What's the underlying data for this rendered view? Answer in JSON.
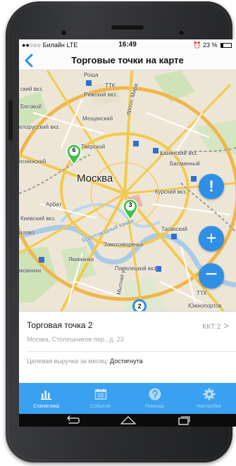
{
  "status": {
    "carrier": "●●○○○ Билайн  LTE",
    "time": "16:49",
    "battery": "23 %"
  },
  "nav": {
    "title": "Торговые точки на карте"
  },
  "map": {
    "city": "Москва",
    "labels": {
      "rogozh": "Рощa",
      "ttk_top": "ТТК",
      "rizhsky": "Рижский вкз.",
      "rizhsky_left": "ский вкз.",
      "begovoy": "Беговой",
      "meshchansky": "Мещанский",
      "prospekt": "просп. Мира",
      "belorussky": "елорусский вкз.",
      "tverskoy": "Тверской",
      "kazansky": "Казанский вкз.",
      "presnensky": "есненский",
      "basmanny": "Басманный",
      "kursky": "Курский вкз.",
      "arbat": "Арбат",
      "kievsky": "Киевский вкз.",
      "ilovo": "илово",
      "taganksy": "Таганский",
      "zamoskvorechye": "Замоскворечье",
      "yakimanka": "Якиманка",
      "paveletsky": "Павелецкий вкз.",
      "mytnaya": "Мытная ул.",
      "ovniki": "мовники",
      "yuzhnoport": "Южнопортов",
      "ttk_bottom": "ТТК",
      "nab": "Болотоводный канал"
    },
    "pins": [
      {
        "number": "6"
      },
      {
        "number": "3"
      },
      {
        "number": "2"
      }
    ],
    "buttons": {
      "alert_glyph": "!",
      "zoom_in_glyph": "+",
      "zoom_out_glyph": "−"
    }
  },
  "point": {
    "name": "Торговая точка 2",
    "kkt": "ККТ:2",
    "kkt_chevron": ">",
    "address": "Москва, Столешников пер., д. 23",
    "goal_label": "Целевая выручка за месяц:",
    "goal_value": "Достигнута"
  },
  "tabs": [
    {
      "label": "Статистика",
      "icon": "bar-chart-icon"
    },
    {
      "label": "События",
      "icon": "calendar-icon"
    },
    {
      "label": "Помощь",
      "icon": "help-icon"
    },
    {
      "label": "Настройки",
      "icon": "gear-icon"
    }
  ],
  "colors": {
    "accent": "#3aa0f0",
    "pin_green": "#3cc24a",
    "pin_blue": "#2b8fe0"
  }
}
